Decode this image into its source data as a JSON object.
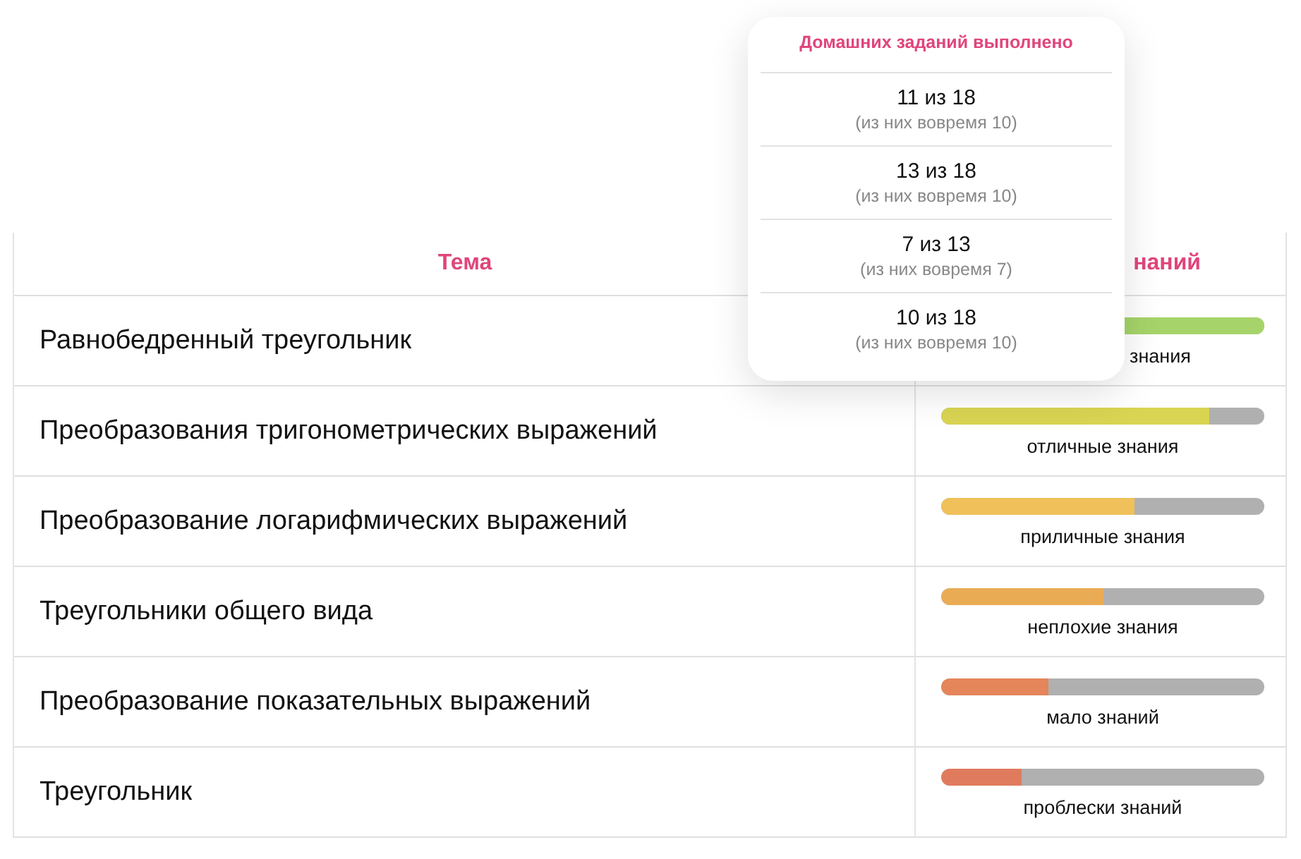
{
  "table": {
    "columns": [
      {
        "label": "Тема"
      },
      {
        "label": "наний",
        "clipped": true
      }
    ],
    "rows": [
      {
        "topic": "Равнобедренный треугольник",
        "level": 1.0,
        "color": "#a6d46a",
        "label": "знания",
        "clipped": true
      },
      {
        "topic": "Преобразования тригонометрических выражений",
        "level": 0.83,
        "color": "#d9d452",
        "label": "отличные знания",
        "clipped": false
      },
      {
        "topic": "Преобразование логарифмических выражений",
        "level": 0.6,
        "color": "#f0c05a",
        "label": "приличные знания",
        "clipped": false
      },
      {
        "topic": "Треугольники общего вида",
        "level": 0.5,
        "color": "#eaab55",
        "label": "неплохие знания",
        "clipped": false
      },
      {
        "topic": "Преобразование показательных выражений",
        "level": 0.33,
        "color": "#e4855a",
        "label": "мало знаний",
        "clipped": false
      },
      {
        "topic": "Треугольник",
        "level": 0.25,
        "color": "#e07b5e",
        "label": "проблески знаний",
        "clipped": false
      }
    ]
  },
  "popup": {
    "title": "Домашних заданий выполнено",
    "items": [
      {
        "main": "11 из 18",
        "sub": "(из них вовремя 10)"
      },
      {
        "main": "13 из 18",
        "sub": "(из них вовремя 10)"
      },
      {
        "main": "7 из 13",
        "sub": "(из них вовремя 7)"
      },
      {
        "main": "10 из 18",
        "sub": "(из них вовремя 10)"
      }
    ]
  }
}
